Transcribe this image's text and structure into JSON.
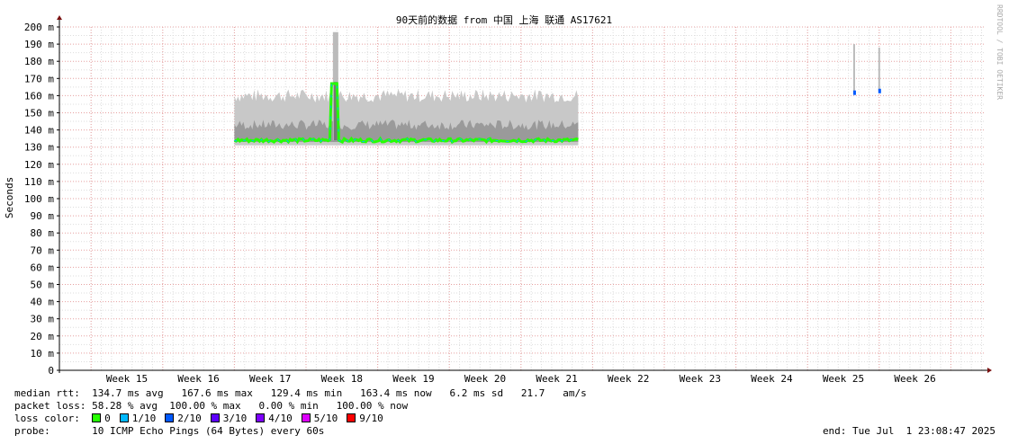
{
  "chart_data": {
    "type": "line",
    "title": "90天前的数据 from 中国 上海 联通 AS17621",
    "ylabel": "Seconds",
    "ylim": [
      0,
      200
    ],
    "yticks": [
      "0",
      "10 m",
      "20 m",
      "30 m",
      "40 m",
      "50 m",
      "60 m",
      "70 m",
      "80 m",
      "90 m",
      "100 m",
      "110 m",
      "120 m",
      "130 m",
      "140 m",
      "150 m",
      "160 m",
      "170 m",
      "180 m",
      "190 m",
      "200 m"
    ],
    "xticks": [
      "Week 15",
      "Week 16",
      "Week 17",
      "Week 18",
      "Week 19",
      "Week 20",
      "Week 21",
      "Week 22",
      "Week 23",
      "Week 24",
      "Week 25",
      "Week 26"
    ],
    "grid": true,
    "watermark": "RRDTOOL / TOBI OETIKER",
    "segments": [
      {
        "start_week": 16.5,
        "end_week": 21.3,
        "median_ms": 134,
        "smoke_max_ms": 160,
        "peak_week": 17.9,
        "peak_ms": 197
      },
      {
        "start_week": 25.12,
        "end_week": 25.18,
        "median_ms": 162,
        "smoke_max_ms": 190
      },
      {
        "start_week": 25.48,
        "end_week": 25.52,
        "median_ms": 163,
        "smoke_max_ms": 188
      }
    ]
  },
  "legend": {
    "median_rtt_label": "median rtt:",
    "median_rtt_values": "134.7 ms avg   167.6 ms max   129.4 ms min   163.4 ms now   6.2 ms sd   21.7   am/s",
    "packet_loss_label": "packet loss:",
    "packet_loss_values": "58.28 % avg  100.00 % max   0.00 % min   100.00 % now",
    "loss_color_label": "loss color:",
    "loss_colors": [
      {
        "label": "0",
        "color": "#26ff00"
      },
      {
        "label": "1/10",
        "color": "#00b8ff"
      },
      {
        "label": "2/10",
        "color": "#0059ff"
      },
      {
        "label": "3/10",
        "color": "#5e00ff"
      },
      {
        "label": "4/10",
        "color": "#7e00ff"
      },
      {
        "label": "5/10",
        "color": "#dd00ff"
      },
      {
        "label": "9/10",
        "color": "#ff0000"
      }
    ],
    "probe_label": "probe:",
    "probe_value": "10 ICMP Echo Pings (64 Bytes) every 60s",
    "end_text": "end: Tue Jul  1 23:08:47 2025"
  }
}
